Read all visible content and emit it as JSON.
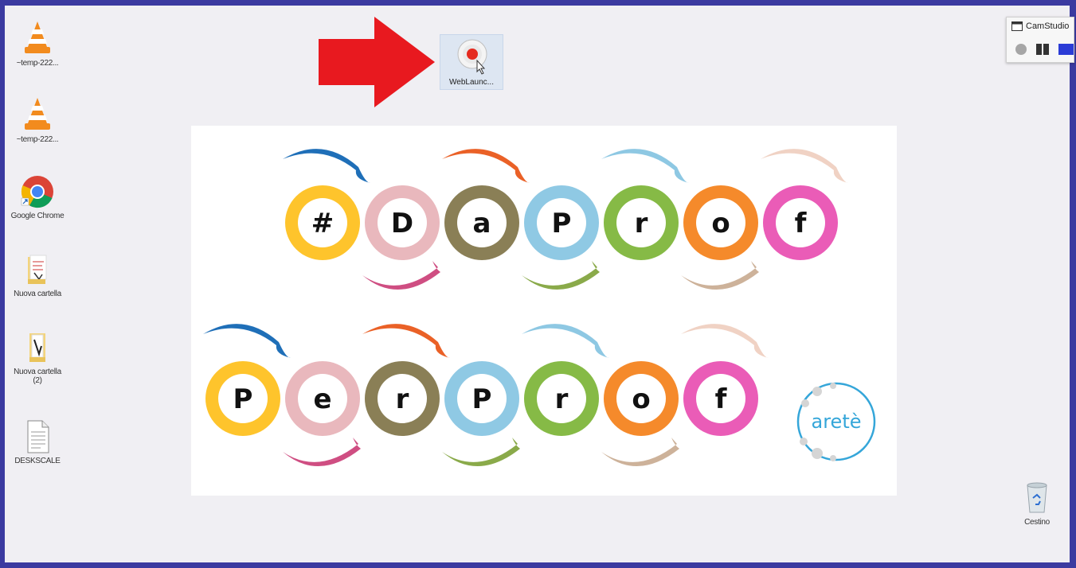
{
  "desktop": {
    "icons": [
      {
        "label": "~temp-222..."
      },
      {
        "label": "~temp-222..."
      },
      {
        "label": "Google Chrome"
      },
      {
        "label": "Nuova cartella"
      },
      {
        "label": "Nuova cartella (2)"
      },
      {
        "label": "DESKSCALE"
      },
      {
        "label": "Cestino"
      }
    ],
    "launcher": {
      "label": "WebLaunc..."
    }
  },
  "camstudio": {
    "title": "CamStudio"
  },
  "wallpaper": {
    "row1": [
      "#",
      "D",
      "a",
      "P",
      "r",
      "o",
      "f"
    ],
    "row2": [
      "P",
      "e",
      "r",
      "P",
      "r",
      "o",
      "f"
    ],
    "logo": "aretè",
    "ring_colors": [
      "#fec42c",
      "#e9b8bd",
      "#8a7f56",
      "#8fc9e4",
      "#86ba46",
      "#f58a2b",
      "#ea5cb7"
    ]
  }
}
